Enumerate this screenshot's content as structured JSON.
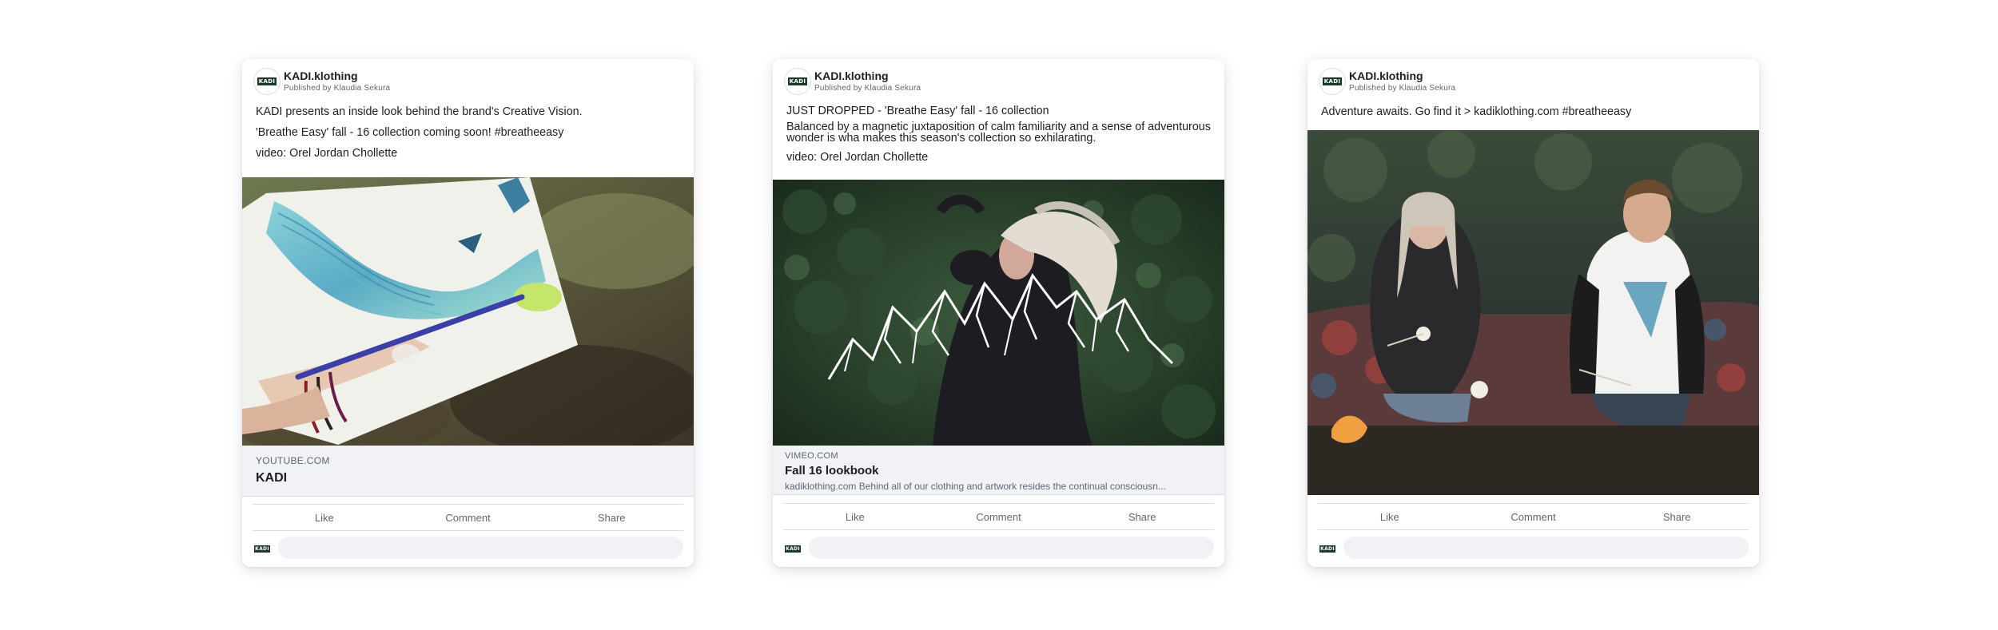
{
  "posts": [
    {
      "page_name": "KADI.klothing",
      "byline": "Published by Klaudia Sekura",
      "avatar_text": "KADI",
      "text": [
        "KADI presents an inside look behind the brand's Creative Vision.",
        "'Breathe Easy' fall - 16 collection coming soon! #breatheeasy",
        "video: Orel Jordan Chollette"
      ],
      "link": {
        "domain": "YOUTUBE.COM",
        "title": "KADI"
      },
      "actions": {
        "like": "Like",
        "comment": "Comment",
        "share": "Share"
      }
    },
    {
      "page_name": "KADI.klothing",
      "byline": "Published by Klaudia Sekura",
      "avatar_text": "KADI",
      "text": [
        "JUST DROPPED - 'Breathe Easy' fall - 16 collection",
        "Balanced by a magnetic juxtaposition of calm familiarity and a sense of adventurous wonder is wha makes this season's collection so exhilarating.",
        "video: Orel Jordan Chollette"
      ],
      "link": {
        "domain": "VIMEO.COM",
        "title": "Fall 16 lookbook",
        "description": "kadiklothing.com Behind all of our clothing and artwork resides the continual consciousn..."
      },
      "actions": {
        "like": "Like",
        "comment": "Comment",
        "share": "Share"
      }
    },
    {
      "page_name": "KADI.klothing",
      "byline": "Published by Klaudia Sekura",
      "avatar_text": "KADI",
      "text": [
        "Adventure awaits. Go find it > kadiklothing.com #breatheeasy"
      ],
      "actions": {
        "like": "Like",
        "comment": "Comment",
        "share": "Share"
      }
    }
  ],
  "colors": {
    "brand_logo_bg": "#1d3b2b",
    "link_preview_bg": "#f0f2f5",
    "secondary_text": "#606770"
  }
}
